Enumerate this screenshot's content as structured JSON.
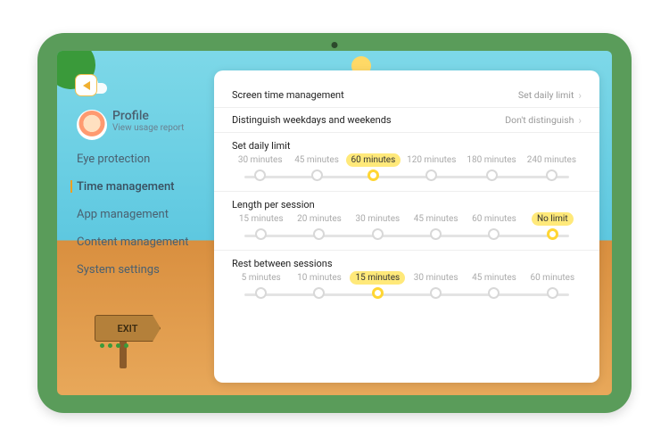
{
  "profile": {
    "title": "Profile",
    "subtitle": "View usage report"
  },
  "menu": {
    "items": [
      {
        "label": "Eye protection"
      },
      {
        "label": "Time management"
      },
      {
        "label": "App management"
      },
      {
        "label": "Content management"
      },
      {
        "label": "System settings"
      }
    ],
    "active_index": 1
  },
  "exit_label": "EXIT",
  "panel": {
    "row1": {
      "label": "Screen time management",
      "value": "Set daily limit"
    },
    "row2": {
      "label": "Distinguish weekdays and weekends",
      "value": "Don't distinguish"
    },
    "sections": [
      {
        "title": "Set daily limit",
        "options": [
          "30 minutes",
          "45 minutes",
          "60 minutes",
          "120 minutes",
          "180 minutes",
          "240 minutes"
        ],
        "selected": 2
      },
      {
        "title": "Length per session",
        "options": [
          "15 minutes",
          "20 minutes",
          "30 minutes",
          "45 minutes",
          "60 minutes",
          "No limit"
        ],
        "selected": 5
      },
      {
        "title": "Rest between sessions",
        "options": [
          "5 minutes",
          "10 minutes",
          "15 minutes",
          "30 minutes",
          "45 minutes",
          "60 minutes"
        ],
        "selected": 2
      }
    ]
  }
}
